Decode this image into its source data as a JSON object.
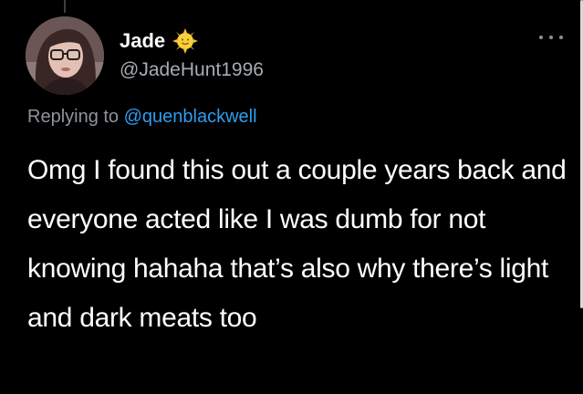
{
  "author": {
    "display_name": "Jade",
    "handle": "@JadeHunt1996",
    "badge_icon": "sun-emoji-icon",
    "avatar_icon": "profile-photo"
  },
  "reply": {
    "prefix": "Replying to",
    "mention": "@quenblackwell"
  },
  "tweet": {
    "text": "Omg I found this out a couple years back and everyone acted like I was dumb for not knowing hahaha that’s also why there’s light and dark meats too"
  },
  "menu": {
    "icon": "more-options-icon"
  },
  "colors": {
    "background": "#000000",
    "text": "#ffffff",
    "secondary": "#a6acb2",
    "link": "#2f9cf0"
  }
}
